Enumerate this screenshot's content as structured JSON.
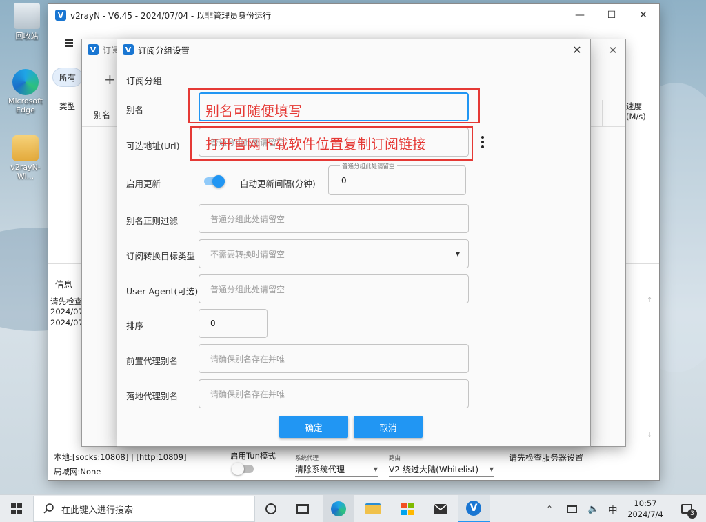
{
  "desktop": {
    "icons": [
      {
        "label": "回收站"
      },
      {
        "label": "Microsoft Edge"
      },
      {
        "label": "v2rayN-Wi..."
      }
    ]
  },
  "main_window": {
    "title": "v2rayN - V6.45 - 2024/07/04 - 以非管理员身份运行",
    "filter_chip": "所有",
    "col_type": "类型",
    "col_speed": "速度(M/s)",
    "info_title": "信息",
    "log_lines": [
      "请先检查服",
      "2024/07/",
      "2024/07/"
    ],
    "status_local": "本地:[socks:10808] | [http:10809]",
    "status_lan": "局域网:None",
    "tun_label": "启用Tun模式",
    "sys_proxy_caption": "系统代理",
    "sys_proxy_value": "清除系统代理",
    "route_caption": "路由",
    "route_value": "V2-绕过大陆(Whitelist)",
    "server_hint": "请先检查服务器设置"
  },
  "sub_window": {
    "title": "订阅",
    "col_alias": "别名",
    "add_icon": "+"
  },
  "dialog": {
    "title": "订阅分组设置",
    "section": "订阅分组",
    "fields": {
      "alias": {
        "label": "别名",
        "value": ""
      },
      "url": {
        "label": "可选地址(Url)",
        "placeholder": "普通分组此处请留空"
      },
      "enable_update": {
        "label": "启用更新",
        "on": true
      },
      "interval": {
        "label": "自动更新间隔(分钟)",
        "caption": "普通分组此处请留空",
        "value": "0"
      },
      "filter": {
        "label": "别名正则过滤",
        "placeholder": "普通分组此处请留空"
      },
      "convert_target": {
        "label": "订阅转换目标类型",
        "placeholder": "不需要转换时请留空"
      },
      "user_agent": {
        "label": "User Agent(可选)",
        "placeholder": "普通分组此处请留空"
      },
      "sort": {
        "label": "排序",
        "value": "0"
      },
      "prev_proxy": {
        "label": "前置代理别名",
        "placeholder": "请确保别名存在并唯一"
      },
      "next_proxy": {
        "label": "落地代理别名",
        "placeholder": "请确保别名存在并唯一"
      }
    },
    "ok_label": "确定",
    "cancel_label": "取消"
  },
  "annotations": {
    "alias_note": "别名可随便填写",
    "url_note": "打开官网下载软件位置复制订阅链接"
  },
  "taskbar": {
    "search_placeholder": "在此键入进行搜索",
    "ime": "中",
    "time": "10:57",
    "date": "2024/7/4",
    "notification_count": "3"
  },
  "colors": {
    "accent": "#2196f3",
    "annotation": "#e53935",
    "brand": "#1976d2"
  }
}
